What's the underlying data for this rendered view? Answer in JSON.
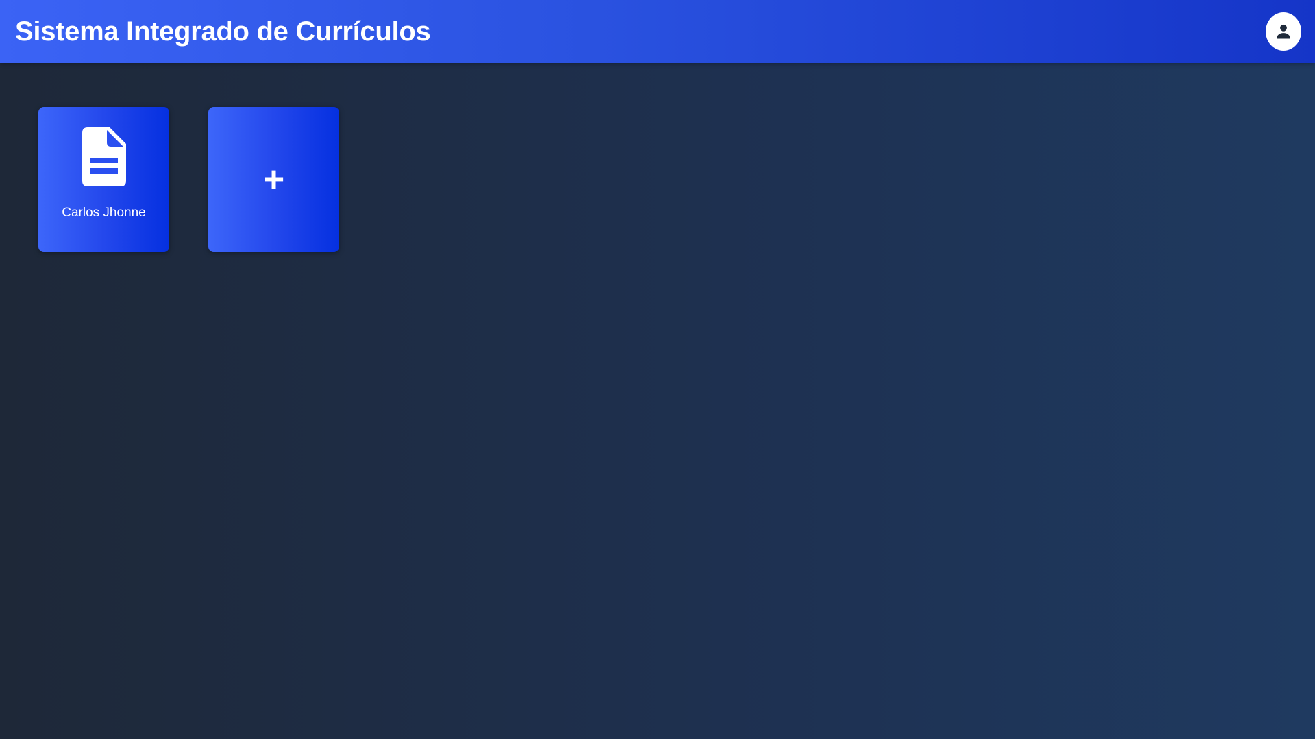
{
  "header": {
    "title": "Sistema Integrado de Currículos",
    "profile_icon": "user-icon"
  },
  "cards": [
    {
      "icon": "document-icon",
      "label": "Carlos Jhonne"
    },
    {
      "icon": "plus-icon",
      "label": "+"
    }
  ],
  "colors": {
    "header_start": "#3b63f5",
    "header_end": "#1535c8",
    "card_start": "#3d66fa",
    "card_end": "#0530e0",
    "background": "#1e2d45"
  }
}
